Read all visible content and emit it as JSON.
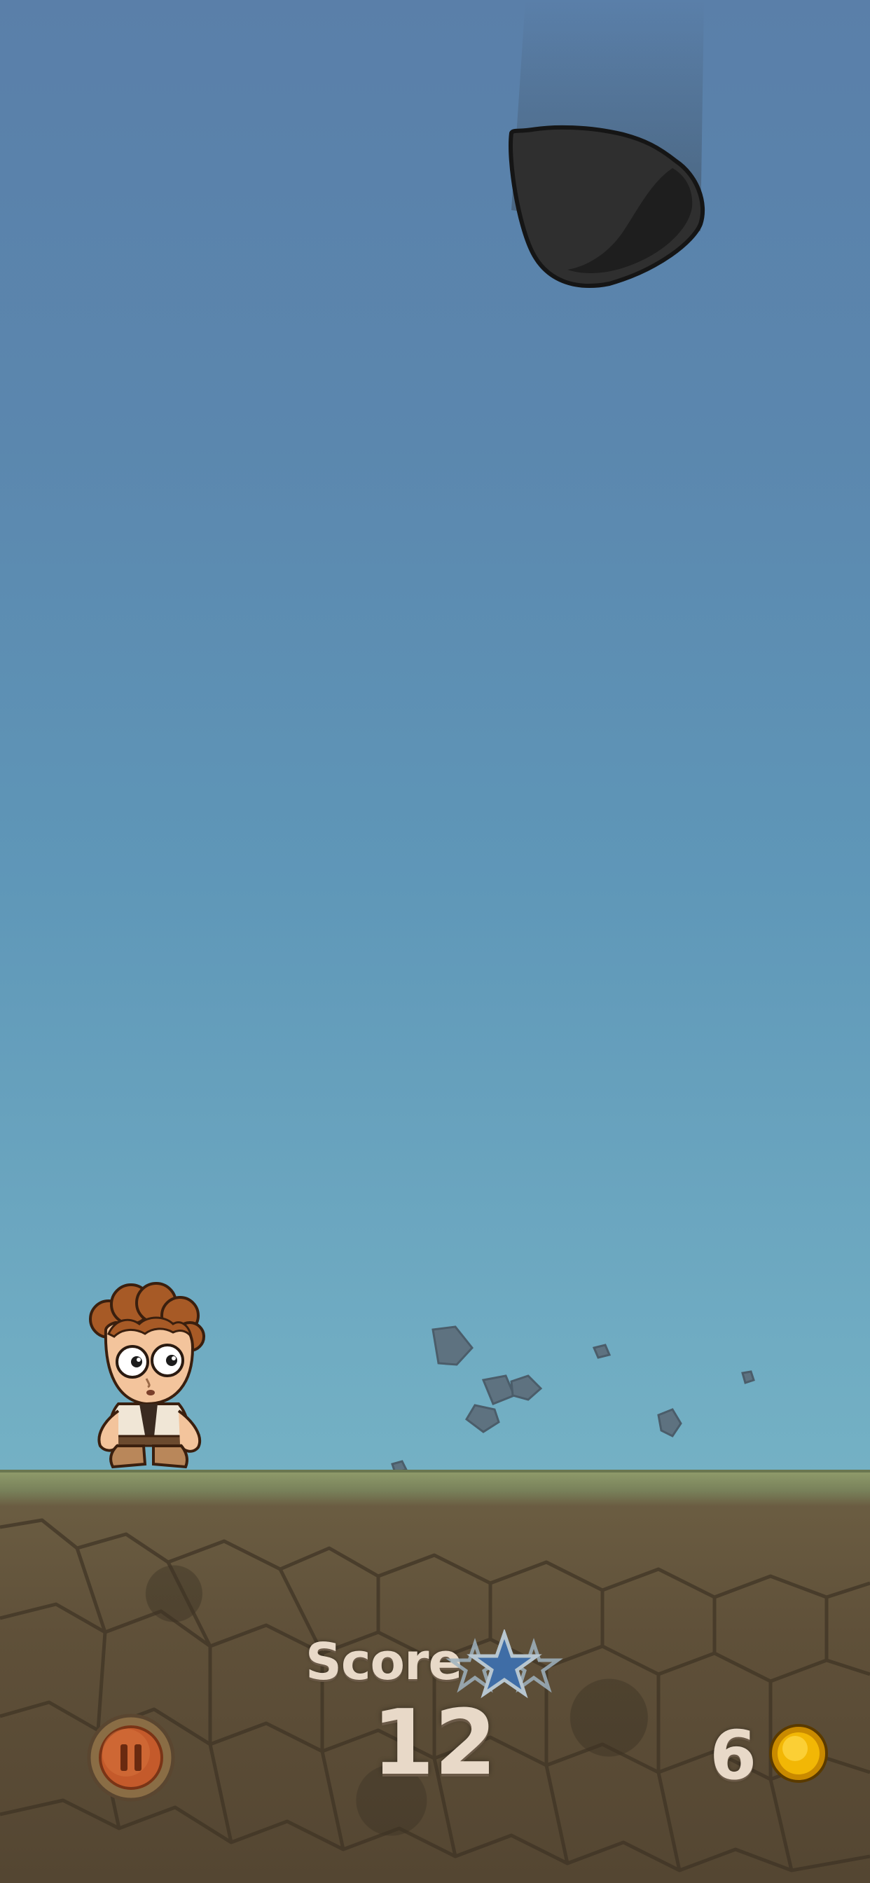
{
  "hud": {
    "score_label": "Score",
    "score_value": "12",
    "coin_count": "6"
  },
  "icons": {
    "pause": "pause-icon",
    "star": "star-icon",
    "coin": "coin-icon",
    "boulder": "boulder",
    "character": "hero-character"
  },
  "colors": {
    "sky_top": "#5a7fa9",
    "sky_bottom": "#74b1c4",
    "ground": "#5f5039",
    "hud_text": "#e8d9c8",
    "star": "#3f6da6",
    "coin": "#f2b705",
    "pause": "#c45a2b"
  }
}
